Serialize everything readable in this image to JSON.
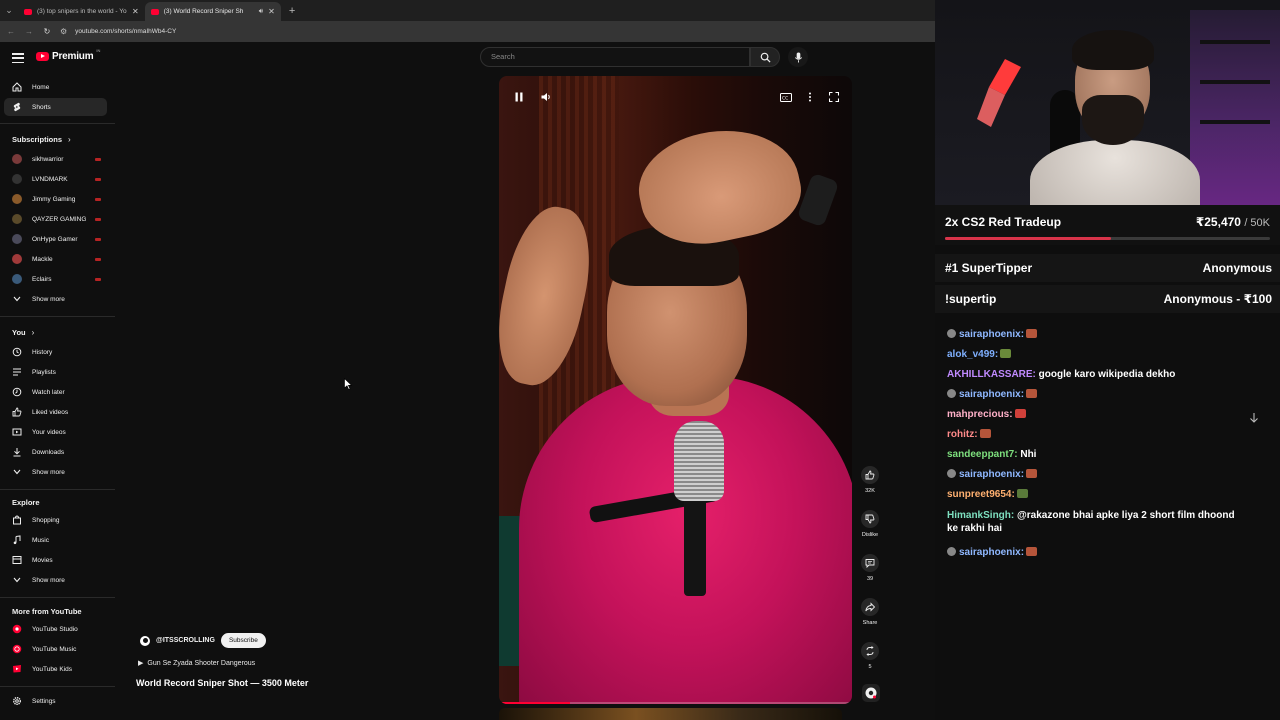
{
  "browser": {
    "tabs": [
      {
        "title": "(3) top snipers in the world - Yo",
        "active": false
      },
      {
        "title": "(3) World Record Sniper Sh",
        "active": true
      }
    ],
    "url": "youtube.com/shorts/nmaIhWb4-CY"
  },
  "header": {
    "logo": "Premium",
    "logo_sup": "IN",
    "search_placeholder": "Search"
  },
  "sidebar": {
    "main": [
      {
        "label": "Home",
        "icon": "home-icon"
      },
      {
        "label": "Shorts",
        "icon": "shorts-icon",
        "active": true
      }
    ],
    "subscriptions_heading": "Subscriptions",
    "subscriptions": [
      {
        "label": "sikhwarrior",
        "color": "#7a3a3a"
      },
      {
        "label": "LVNDMARK",
        "color": "#333333"
      },
      {
        "label": "Jimmy Gaming",
        "color": "#8a5a2a"
      },
      {
        "label": "QAYZER GAMING",
        "color": "#5a4a2a"
      },
      {
        "label": "OnHype Gamer",
        "color": "#4a4a5a"
      },
      {
        "label": "Mackle",
        "color": "#a03a3a"
      },
      {
        "label": "Eclairs",
        "color": "#3a5a7a"
      }
    ],
    "show_more": "Show more",
    "you_heading": "You",
    "you": [
      {
        "label": "History",
        "icon": "history-icon"
      },
      {
        "label": "Playlists",
        "icon": "playlists-icon"
      },
      {
        "label": "Watch later",
        "icon": "watch-later-icon"
      },
      {
        "label": "Liked videos",
        "icon": "like-icon"
      },
      {
        "label": "Your videos",
        "icon": "your-videos-icon"
      },
      {
        "label": "Downloads",
        "icon": "download-icon"
      }
    ],
    "explore_heading": "Explore",
    "explore": [
      {
        "label": "Shopping",
        "icon": "shopping-icon"
      },
      {
        "label": "Music",
        "icon": "music-icon"
      },
      {
        "label": "Movies",
        "icon": "movies-icon"
      }
    ],
    "more_heading": "More from YouTube",
    "more": [
      {
        "label": "YouTube Studio"
      },
      {
        "label": "YouTube Music"
      },
      {
        "label": "YouTube Kids"
      }
    ],
    "settings": "Settings"
  },
  "short": {
    "channel": "@ITSSCROLLING",
    "subscribe": "Subscribe",
    "sound": "Gun Se Zyada Shooter Dangerous",
    "title": "World Record Sniper Shot — 3500 Meter",
    "progress_percent": 20,
    "actions": [
      {
        "icon": "thumbs-up-icon",
        "label": "32K"
      },
      {
        "icon": "thumbs-down-icon",
        "label": "Dislike"
      },
      {
        "icon": "comment-icon",
        "label": "39"
      },
      {
        "icon": "share-icon",
        "label": "Share"
      },
      {
        "icon": "remix-icon",
        "label": "5"
      }
    ]
  },
  "stream": {
    "goal_title": "2x CS2 Red Tradeup",
    "goal_amount": "₹25,470",
    "goal_target": "/ 50K",
    "goal_fraction": 0.51,
    "supertipper_label": "#1 SuperTipper",
    "supertipper_value": "Anonymous",
    "command_label": "!supertip",
    "command_value": "Anonymous - ₹100",
    "chat": [
      {
        "user": "sairaphoenix:",
        "text": "",
        "color": "#8fb8ff",
        "badge": true,
        "emote": "#b5553a"
      },
      {
        "user": "alok_v499:",
        "text": "",
        "color": "#7fb0ff",
        "badge": false,
        "emote": "#6a8a3a"
      },
      {
        "user": "AKHILLKASSARE:",
        "text": "google karo wikipedia dekho",
        "color": "#c08aff",
        "badge": false,
        "emote": ""
      },
      {
        "user": "sairaphoenix:",
        "text": "",
        "color": "#8fb8ff",
        "badge": true,
        "emote": "#b5553a"
      },
      {
        "user": "mahprecious:",
        "text": "",
        "color": "#ffb0c8",
        "badge": false,
        "emote": "#d0403a"
      },
      {
        "user": "rohitz:",
        "text": "",
        "color": "#ff8a8a",
        "badge": false,
        "emote": "#b5553a"
      },
      {
        "user": "sandeeppant7:",
        "text": "Nhi",
        "color": "#7ee07e",
        "badge": false,
        "emote": ""
      },
      {
        "user": "sairaphoenix:",
        "text": "",
        "color": "#8fb8ff",
        "badge": true,
        "emote": "#b5553a"
      },
      {
        "user": "sunpreet9654:",
        "text": "",
        "color": "#ffb070",
        "badge": false,
        "emote": "#5a7a3a"
      },
      {
        "user": "HimankSingh:",
        "text": "@rakazone bhai apke liya 2 short film dhoond ke rakhi hai",
        "color": "#7ee0c0",
        "badge": false,
        "emote": ""
      },
      {
        "user": "sairaphoenix:",
        "text": "",
        "color": "#8fb8ff",
        "badge": true,
        "emote": "#b5553a"
      }
    ]
  }
}
